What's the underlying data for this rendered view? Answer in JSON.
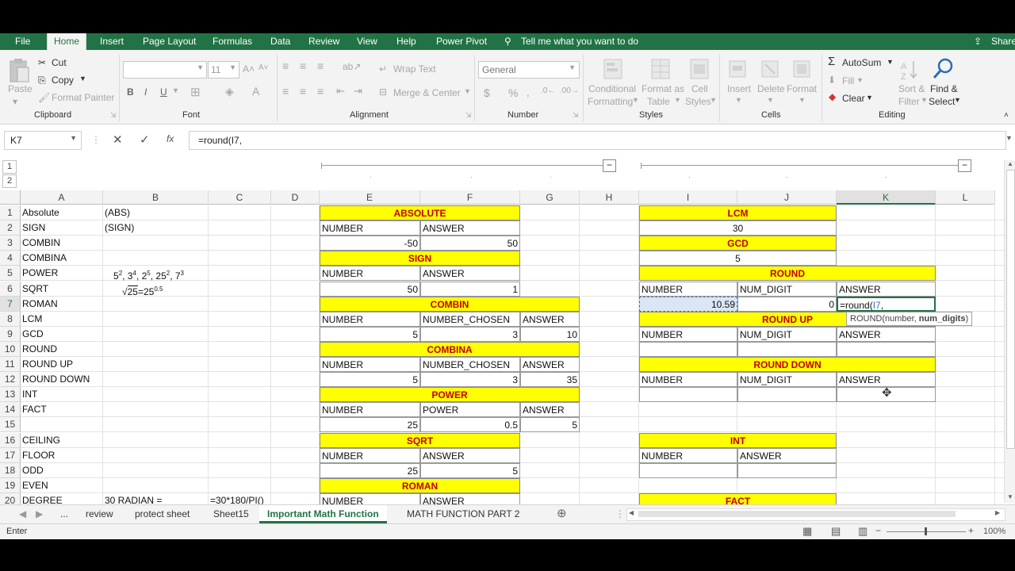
{
  "ribbon_tabs": [
    "File",
    "Home",
    "Insert",
    "Page Layout",
    "Formulas",
    "Data",
    "Review",
    "View",
    "Help",
    "Power Pivot"
  ],
  "tell_me": "Tell me what you want to do",
  "share": "Share",
  "clipboard": {
    "paste": "Paste",
    "cut": "Cut",
    "copy": "Copy",
    "format_painter": "Format Painter",
    "label": "Clipboard"
  },
  "font": {
    "name": "",
    "size": "11",
    "label": "Font",
    "bold": "B",
    "italic": "I",
    "underline": "U"
  },
  "alignment": {
    "wrap": "Wrap Text",
    "merge": "Merge & Center",
    "label": "Alignment"
  },
  "number": {
    "format": "General",
    "currency": "$",
    "percent": "%",
    "label": "Number"
  },
  "styles": {
    "conditional": "Conditional",
    "conditional2": "Formatting",
    "format_as": "Format as",
    "table": "Table",
    "cell": "Cell",
    "styles": "Styles",
    "label": "Styles"
  },
  "cells": {
    "insert": "Insert",
    "delete": "Delete",
    "format": "Format",
    "label": "Cells"
  },
  "editing": {
    "autosum": "AutoSum",
    "fill": "Fill",
    "clear": "Clear",
    "sort": "Sort &",
    "filter": "Filter",
    "find": "Find &",
    "select": "Select",
    "label": "Editing"
  },
  "namebox": "K7",
  "formula": "=round(I7,",
  "fx": "fx",
  "outline_levels": [
    "1",
    "2"
  ],
  "columns": [
    "A",
    "B",
    "C",
    "D",
    "E",
    "F",
    "G",
    "H",
    "I",
    "J",
    "K",
    "L"
  ],
  "rows": [
    "1",
    "2",
    "3",
    "4",
    "5",
    "6",
    "7",
    "8",
    "9",
    "10",
    "11",
    "12",
    "13",
    "14",
    "15",
    "16",
    "17",
    "18",
    "19",
    "20"
  ],
  "colA": [
    "Absolute",
    "SIGN",
    "COMBIN",
    "COMBINA",
    "POWER",
    "SQRT",
    "ROMAN",
    "LCM",
    "GCD",
    "ROUND",
    "ROUND UP",
    "ROUND DOWN",
    "INT",
    "FACT",
    "",
    "CEILING",
    "FLOOR",
    "ODD",
    "EVEN",
    "DEGREE"
  ],
  "colB": {
    "r1": "(ABS)",
    "r2": "(SIGN)",
    "r20": "30 RADIAN ="
  },
  "c20": "=30*180/PI()",
  "b5": {
    "a": "5",
    "ae": "2",
    "b": ", 3",
    "be": "4",
    "c": ", 2",
    "ce": "5",
    "d": ", 25",
    "de": "2",
    "e": ", 7",
    "ee": "3"
  },
  "b6": {
    "root": "√",
    "rad": "25",
    "eq": "=25",
    "exp": "0.5"
  },
  "blocks": {
    "absolute": "ABSOLUTE",
    "sign": "SIGN",
    "combin": "COMBIN",
    "combina": "COMBINA",
    "power": "POWER",
    "sqrt": "SQRT",
    "roman": "ROMAN",
    "lcm": "LCM",
    "gcd": "GCD",
    "round": "ROUND",
    "roundup": "ROUND UP",
    "rounddown": "ROUND DOWN",
    "int": "INT",
    "fact": "FACT"
  },
  "hdr": {
    "number": "NUMBER",
    "answer": "ANSWER",
    "num_chosen": "NUMBER_CHOSEN",
    "power": "POWER",
    "num_digit": "NUM_DIGIT"
  },
  "vals": {
    "e3": "-50",
    "f3": "50",
    "e6": "50",
    "f6": "1",
    "e9": "5",
    "f9": "3",
    "g9": "10",
    "e12": "5",
    "f12": "3",
    "g12": "35",
    "e15": "25",
    "f15": "0.5",
    "g15": "5",
    "e18": "25",
    "f18": "5",
    "i2": "30",
    "i4": "5",
    "i7": "10.59",
    "j7": "0",
    "k7": "=round(I7,",
    "k7_ref": "I7"
  },
  "tooltip": {
    "fn": "ROUND(number, ",
    "arg": "num_digits",
    ")": ")"
  },
  "sheets": [
    "...",
    "review",
    "protect sheet",
    "Sheet15",
    "Important Math Function",
    "MATH FUNCTION PART 2"
  ],
  "status": "Enter",
  "zoom": "100%"
}
